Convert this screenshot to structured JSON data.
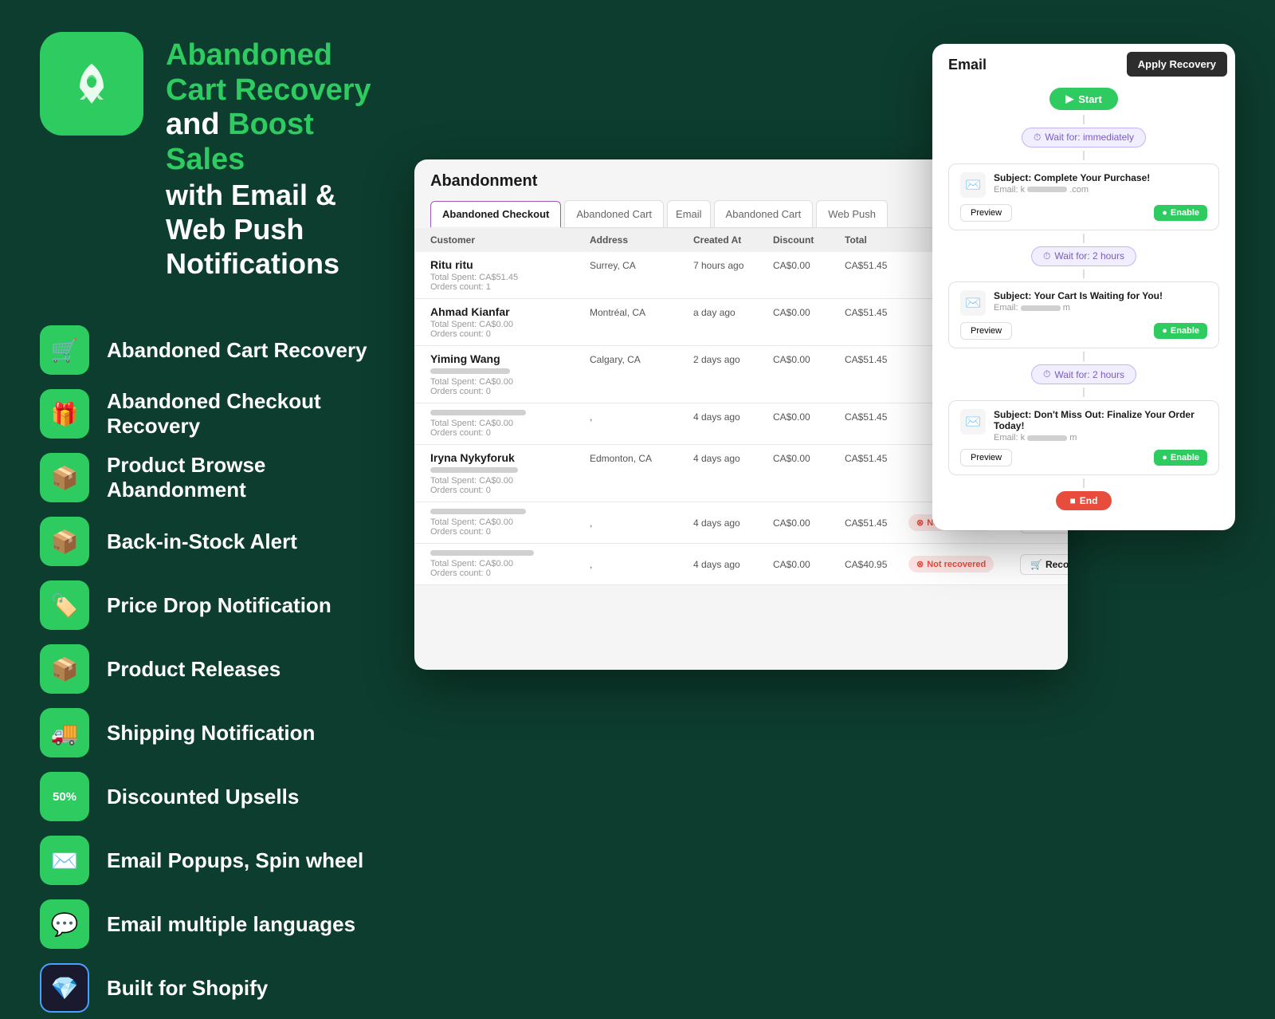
{
  "background": "#0d3d2e",
  "header": {
    "title_green": "Abandoned Cart Recovery",
    "title_and": " and ",
    "title_boost_green": "Boost Sales",
    "title_line2": "with Email & Web Push Notifications"
  },
  "features": [
    {
      "id": "abandoned-cart",
      "icon": "🛒",
      "label": "Abandoned Cart Recovery",
      "bold": false
    },
    {
      "id": "abandoned-checkout",
      "icon": "🎁",
      "label": "Abandoned Checkout Recovery",
      "bold": false
    },
    {
      "id": "product-browse",
      "icon": "📦",
      "label": "Product Browse Abandonment",
      "bold": false
    },
    {
      "id": "back-in-stock",
      "icon": "📦",
      "label": "Back-in-Stock Alert",
      "bold": false
    },
    {
      "id": "price-drop",
      "icon": "🏷️",
      "label": "Price Drop Notification",
      "bold": false
    },
    {
      "id": "product-releases",
      "icon": "📦",
      "label": "Product Releases",
      "bold": false
    },
    {
      "id": "shipping",
      "icon": "🚚",
      "label": "Shipping Notification",
      "bold": false
    },
    {
      "id": "discounted-upsells",
      "icon": "50%",
      "label": "Discounted Upsells",
      "bold": false,
      "special": "percent"
    },
    {
      "id": "email-popups",
      "icon": "✉️",
      "label": "Email Popups, Spin wheel",
      "bold": false
    },
    {
      "id": "email-languages",
      "icon": "💬",
      "label": "Email multiple languages",
      "bold": false
    },
    {
      "id": "shopify",
      "icon": "💎",
      "label": "Built for Shopify",
      "bold": true
    }
  ],
  "table": {
    "title": "Abandonment",
    "tabs": [
      {
        "id": "abandoned-checkout",
        "label": "Abandoned Checkout",
        "active": true
      },
      {
        "id": "abandoned-cart-email",
        "label": "Abandoned Cart",
        "active": false
      },
      {
        "id": "email",
        "label": "Email",
        "active": false
      },
      {
        "id": "abandoned-cart-web",
        "label": "Abandoned Cart",
        "active": false
      },
      {
        "id": "web-push",
        "label": "Web Push",
        "active": false
      }
    ],
    "columns": [
      "Customer",
      "Address",
      "Created At",
      "Discount",
      "Total"
    ],
    "rows": [
      {
        "name": "Ritu ritu",
        "address": "Surrey,  CA",
        "created_at": "7 hours ago",
        "discount": "CA$0.00",
        "total": "CA$51.45",
        "spent": "Total Spent: CA$51.45",
        "orders": "Orders count: 1",
        "status": null,
        "recover": null
      },
      {
        "name": "Ahmad Kianfar",
        "address": "Montréal,  CA",
        "created_at": "a day ago",
        "discount": "CA$0.00",
        "total": "CA$51.45",
        "spent": "Total Spent: CA$0.00",
        "orders": "Orders count: 0",
        "status": null,
        "recover": null
      },
      {
        "name": "Yiming Wang",
        "address": "Calgary,  CA",
        "created_at": "2 days ago",
        "discount": "CA$0.00",
        "total": "CA$51.45",
        "spent": "Total Spent: CA$0.00",
        "orders": "Orders count: 0",
        "status": null,
        "recover": null
      },
      {
        "name": "",
        "address": ",",
        "created_at": "4 days ago",
        "discount": "CA$0.00",
        "total": "CA$51.45",
        "spent": "Total Spent: CA$0.00",
        "orders": "Orders count: 0",
        "status": null,
        "recover": null
      },
      {
        "name": "Iryna Nykyforuk",
        "address": "Edmonton,  CA",
        "created_at": "4 days ago",
        "discount": "CA$0.00",
        "total": "CA$51.45",
        "spent": "Total Spent: CA$0.00",
        "orders": "Orders count: 0",
        "status": null,
        "recover": null
      },
      {
        "name": "",
        "address": ",",
        "created_at": "4 days ago",
        "discount": "CA$0.00",
        "total": "CA$51.45",
        "spent": "Total Spent: CA$0.00",
        "orders": "Orders count: 0",
        "status": "Not recovered",
        "recover": "Recover"
      },
      {
        "name": "",
        "address": ",",
        "created_at": "4 days ago",
        "discount": "CA$0.00",
        "total": "CA$40.95",
        "spent": "Total Spent: CA$0.00",
        "orders": "Orders count: 0",
        "status": "Not recovered",
        "recover": "Recover"
      }
    ]
  },
  "email_panel": {
    "apply_label": "Apply Recovery",
    "header_label": "Email",
    "start_label": "Start",
    "wait1_label": "Wait for: immediately",
    "email1": {
      "subject": "Subject: Complete Your Purchase!",
      "from": "Email: k",
      "from_suffix": ".com",
      "preview_label": "Preview",
      "enable_label": "Enable"
    },
    "wait2_label": "Wait for: 2 hours",
    "email2": {
      "subject": "Subject: Your Cart Is Waiting for You!",
      "from": "Email: ",
      "from_suffix": "m",
      "preview_label": "Preview",
      "enable_label": "Enable"
    },
    "wait3_label": "Wait for: 2 hours",
    "email3": {
      "subject": "Subject: Don't Miss Out: Finalize Your Order Today!",
      "from": "Email: k",
      "from_suffix": "m",
      "preview_label": "Preview",
      "enable_label": "Enable"
    },
    "end_label": "End"
  }
}
